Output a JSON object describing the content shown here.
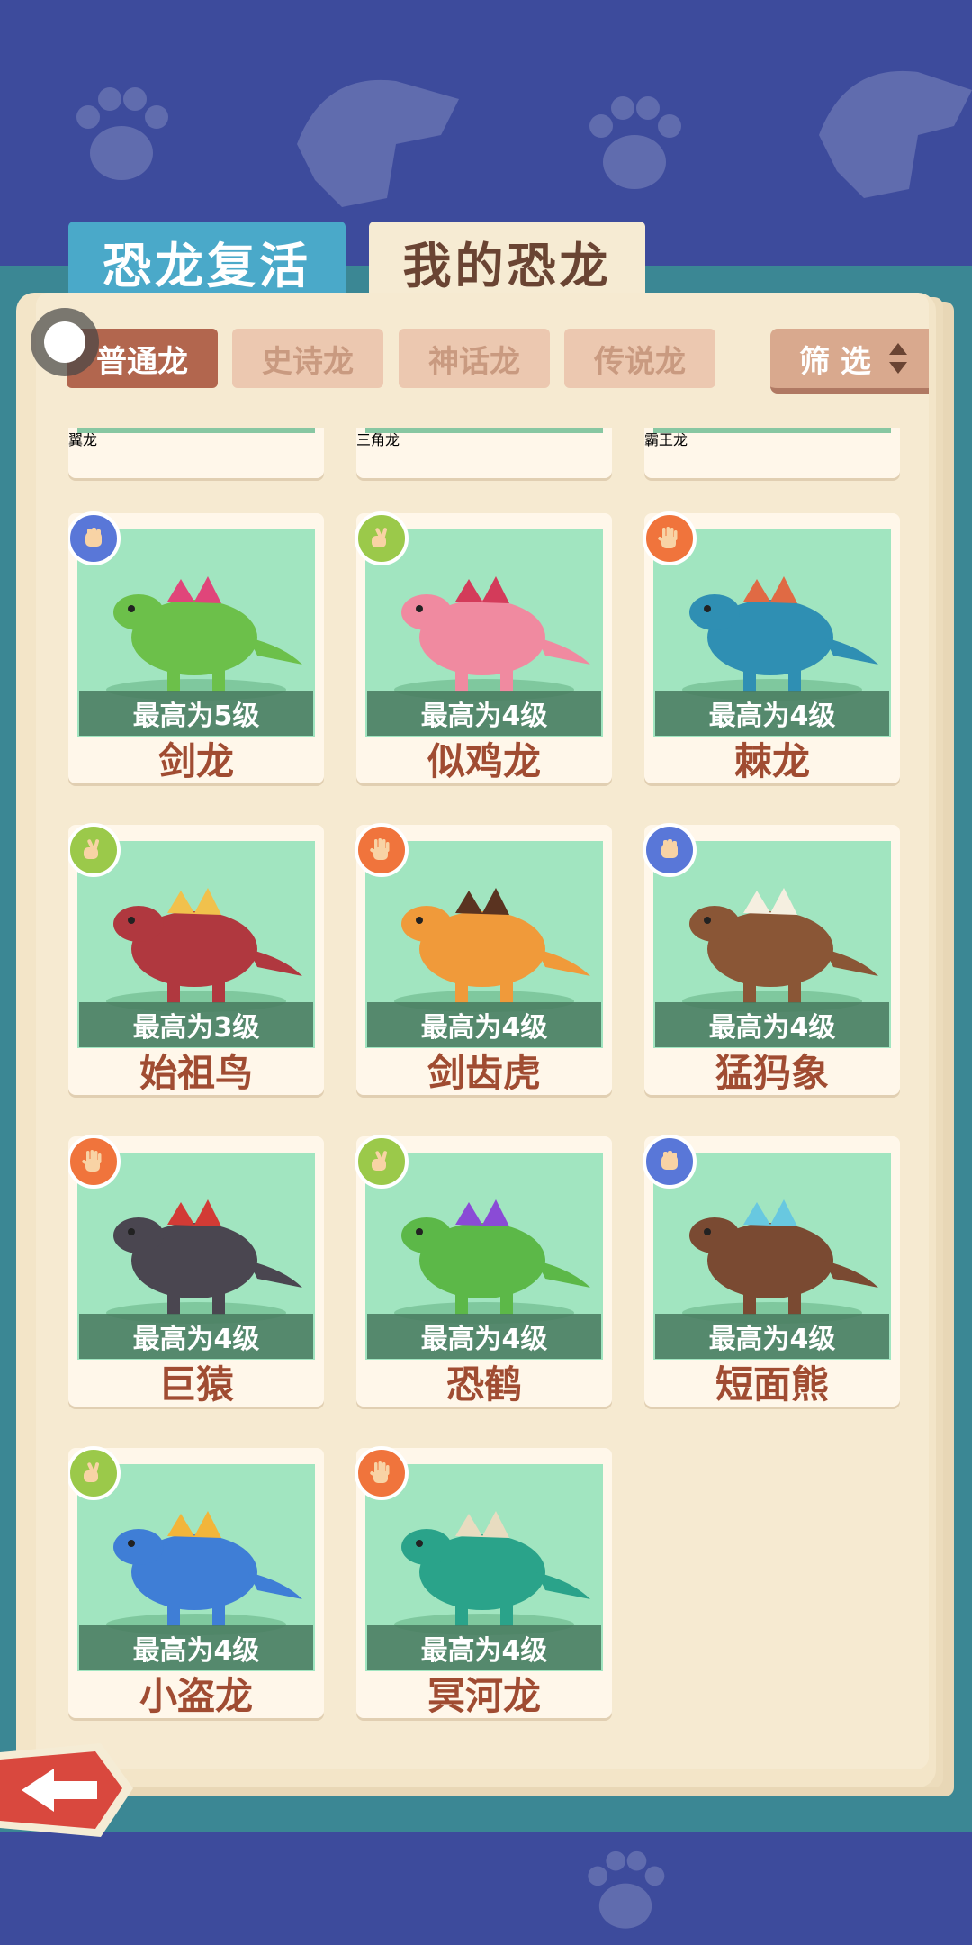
{
  "tabs": {
    "revive": "恐龙复活",
    "mine": "我的恐龙"
  },
  "filters": {
    "items": [
      "普通龙",
      "史诗龙",
      "神话龙",
      "传说龙"
    ],
    "active_index": 0,
    "screen_label": "筛 选"
  },
  "top_partial_cards": [
    "翼龙",
    "三角龙",
    "霸王龙"
  ],
  "cards": [
    {
      "name": "剑龙",
      "level": "最高为5级",
      "badge": "blue",
      "badge_icon": "fist-icon",
      "creature_color": "#6cc04a",
      "accent": "#e0457a"
    },
    {
      "name": "似鸡龙",
      "level": "最高为4级",
      "badge": "green",
      "badge_icon": "scissors-hand-icon",
      "creature_color": "#f08aa0",
      "accent": "#d33b5a"
    },
    {
      "name": "棘龙",
      "level": "最高为4级",
      "badge": "orange",
      "badge_icon": "open-palm-icon",
      "creature_color": "#2f8fb3",
      "accent": "#e06a44"
    },
    {
      "name": "始祖鸟",
      "level": "最高为3级",
      "badge": "green",
      "badge_icon": "scissors-hand-icon",
      "creature_color": "#b0383f",
      "accent": "#f1c14c"
    },
    {
      "name": "剑齿虎",
      "level": "最高为4级",
      "badge": "orange",
      "badge_icon": "open-palm-icon",
      "creature_color": "#f09a3a",
      "accent": "#5a3320"
    },
    {
      "name": "猛犸象",
      "level": "最高为4级",
      "badge": "blue",
      "badge_icon": "fist-icon",
      "creature_color": "#8a5636",
      "accent": "#f5efe0"
    },
    {
      "name": "巨猿",
      "level": "最高为4级",
      "badge": "orange",
      "badge_icon": "open-palm-icon",
      "creature_color": "#4a4650",
      "accent": "#d23b35"
    },
    {
      "name": "恐鹤",
      "level": "最高为4级",
      "badge": "green",
      "badge_icon": "scissors-hand-icon",
      "creature_color": "#5cb848",
      "accent": "#8a4bd6"
    },
    {
      "name": "短面熊",
      "level": "最高为4级",
      "badge": "blue",
      "badge_icon": "fist-icon",
      "creature_color": "#7a4a32",
      "accent": "#68c8e0"
    },
    {
      "name": "小盗龙",
      "level": "最高为4级",
      "badge": "green",
      "badge_icon": "scissors-hand-icon",
      "creature_color": "#3f7ed6",
      "accent": "#f2b53a"
    },
    {
      "name": "冥河龙",
      "level": "最高为4级",
      "badge": "orange",
      "badge_icon": "open-palm-icon",
      "creature_color": "#2aa38a",
      "accent": "#e8dcc0"
    }
  ],
  "colors": {
    "background": "#3d4b9c",
    "page": "#f6ead1",
    "card_image_bg": "#a1e5c0",
    "name_text": "#a04c32",
    "back_button": "#d9483e"
  }
}
